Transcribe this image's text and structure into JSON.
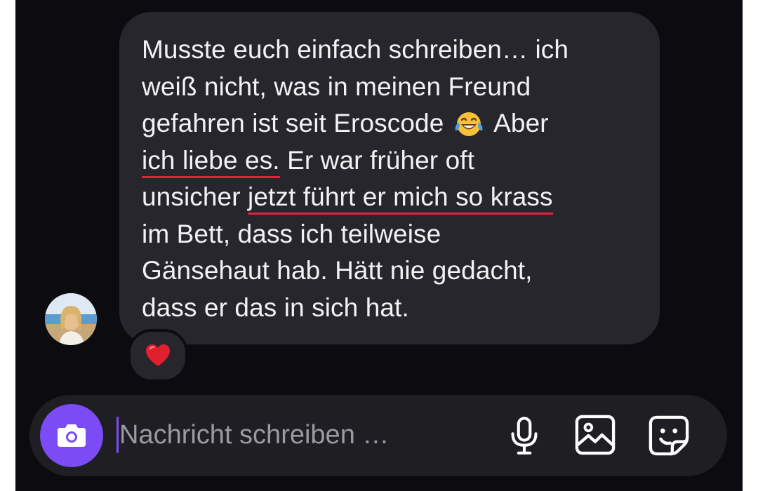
{
  "chat": {
    "message": {
      "line1": "Musste euch einfach schreiben… ich",
      "line2": "weiß nicht, was in meinen Freund",
      "line3_before": "gefahren ist seit Eroscode ",
      "line3_after": " Aber",
      "line4_highlight": "ich liebe es.",
      "line4_after": " Er war früher oft",
      "line5_before": "unsicher ",
      "line5_highlight": "jetzt führt er mich so krass",
      "line6": "im Bett, dass ich teilweise",
      "line7": "Gänsehaut hab. Hätt nie gedacht,",
      "line8": "dass er das in sich hat."
    },
    "emoji_icon": "face-with-tears-of-joy-icon",
    "reaction_icon": "red-heart-icon",
    "highlight_color": "#e3213a"
  },
  "composer": {
    "placeholder": "Nachricht schreiben …",
    "accent_color": "#7b4cf6",
    "icons": [
      "camera-icon",
      "microphone-icon",
      "gallery-icon",
      "sticker-icon"
    ]
  }
}
